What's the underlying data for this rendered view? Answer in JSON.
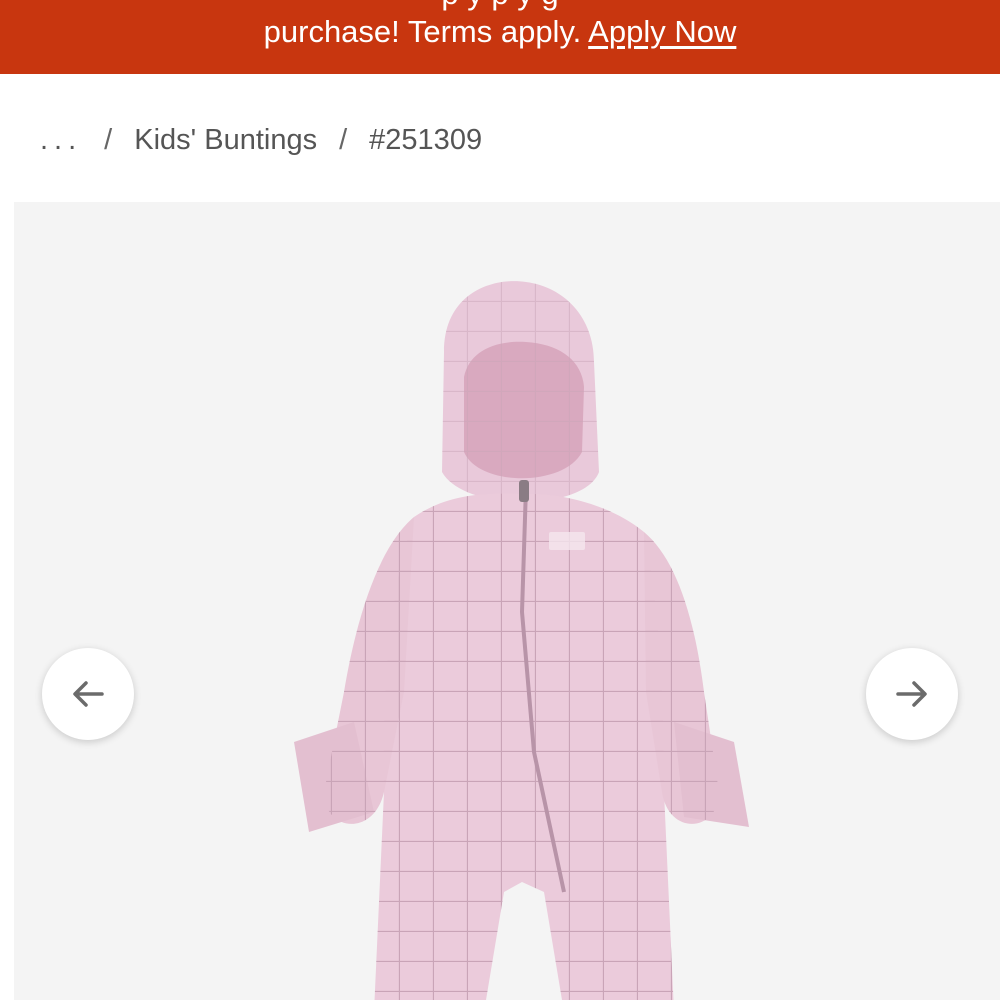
{
  "banner": {
    "line_partial": "p                    y                        p     y  g",
    "text": "purchase! Terms apply.",
    "link": "Apply Now"
  },
  "breadcrumb": {
    "ellipsis": "...",
    "separator": "/",
    "category": "Kids' Buntings",
    "item_id": "#251309"
  },
  "gallery": {
    "image_subject": "pink hooded quilted baby bunting",
    "prev_icon": "arrow-left-icon",
    "next_icon": "arrow-right-icon"
  },
  "colors": {
    "banner_bg": "#c8360f",
    "gallery_bg": "#f4f4f4",
    "product_pink": "#e8c8d8"
  }
}
